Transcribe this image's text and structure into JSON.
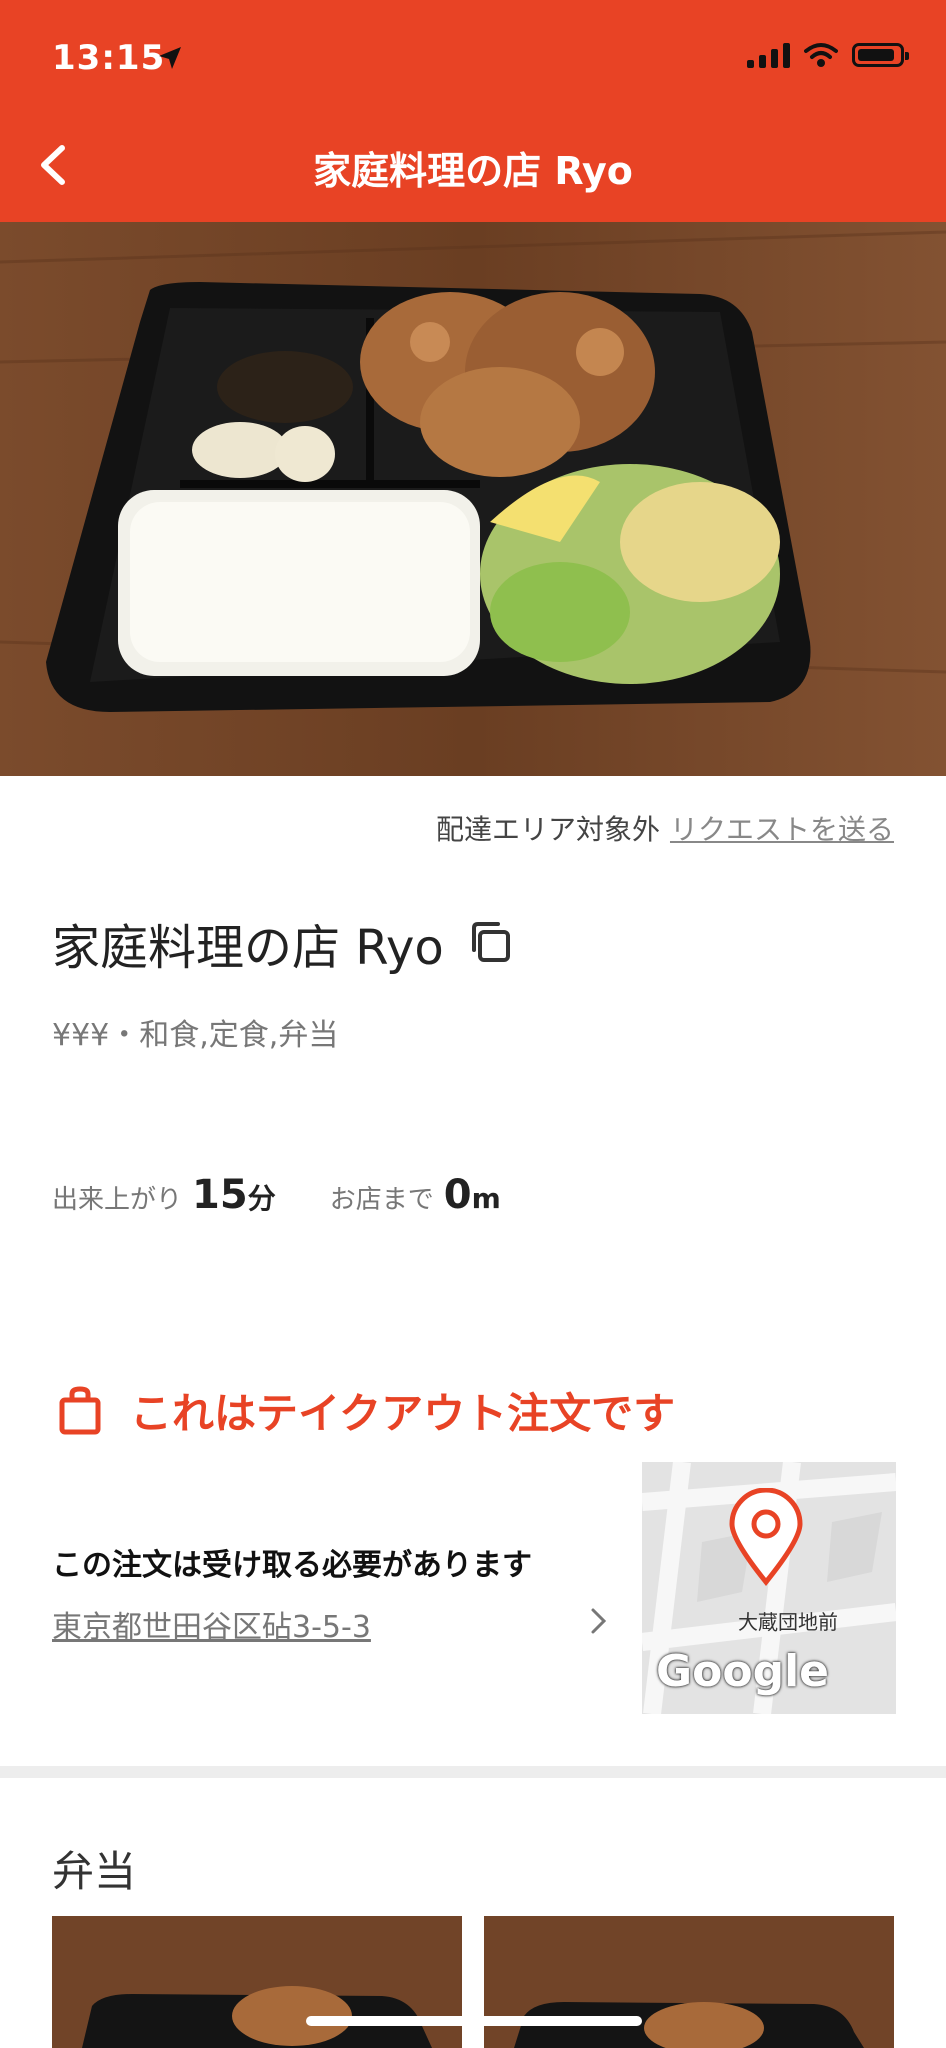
{
  "status_bar": {
    "time": "13:15"
  },
  "header": {
    "title": "家庭料理の店 Ryo"
  },
  "delivery": {
    "note": "配達エリア対象外",
    "request_link": "リクエストを送る"
  },
  "store": {
    "name": "家庭料理の店 Ryo",
    "meta": "¥¥¥・和食,定食,弁当"
  },
  "stats": {
    "ready_label": "出来上がり",
    "ready_value": "15",
    "ready_unit": "分",
    "distance_label": "お店まで",
    "distance_value": "0",
    "distance_unit": "m"
  },
  "takeout": {
    "banner": "これはテイクアウト注文です"
  },
  "pickup": {
    "title": "この注文は受け取る必要があります",
    "address": "東京都世田谷区砧3-5-3"
  },
  "map": {
    "place_label": "大蔵団地前",
    "brand": "Google"
  },
  "menu": {
    "section_title": "弁当"
  },
  "colors": {
    "brand": "#e84325"
  }
}
